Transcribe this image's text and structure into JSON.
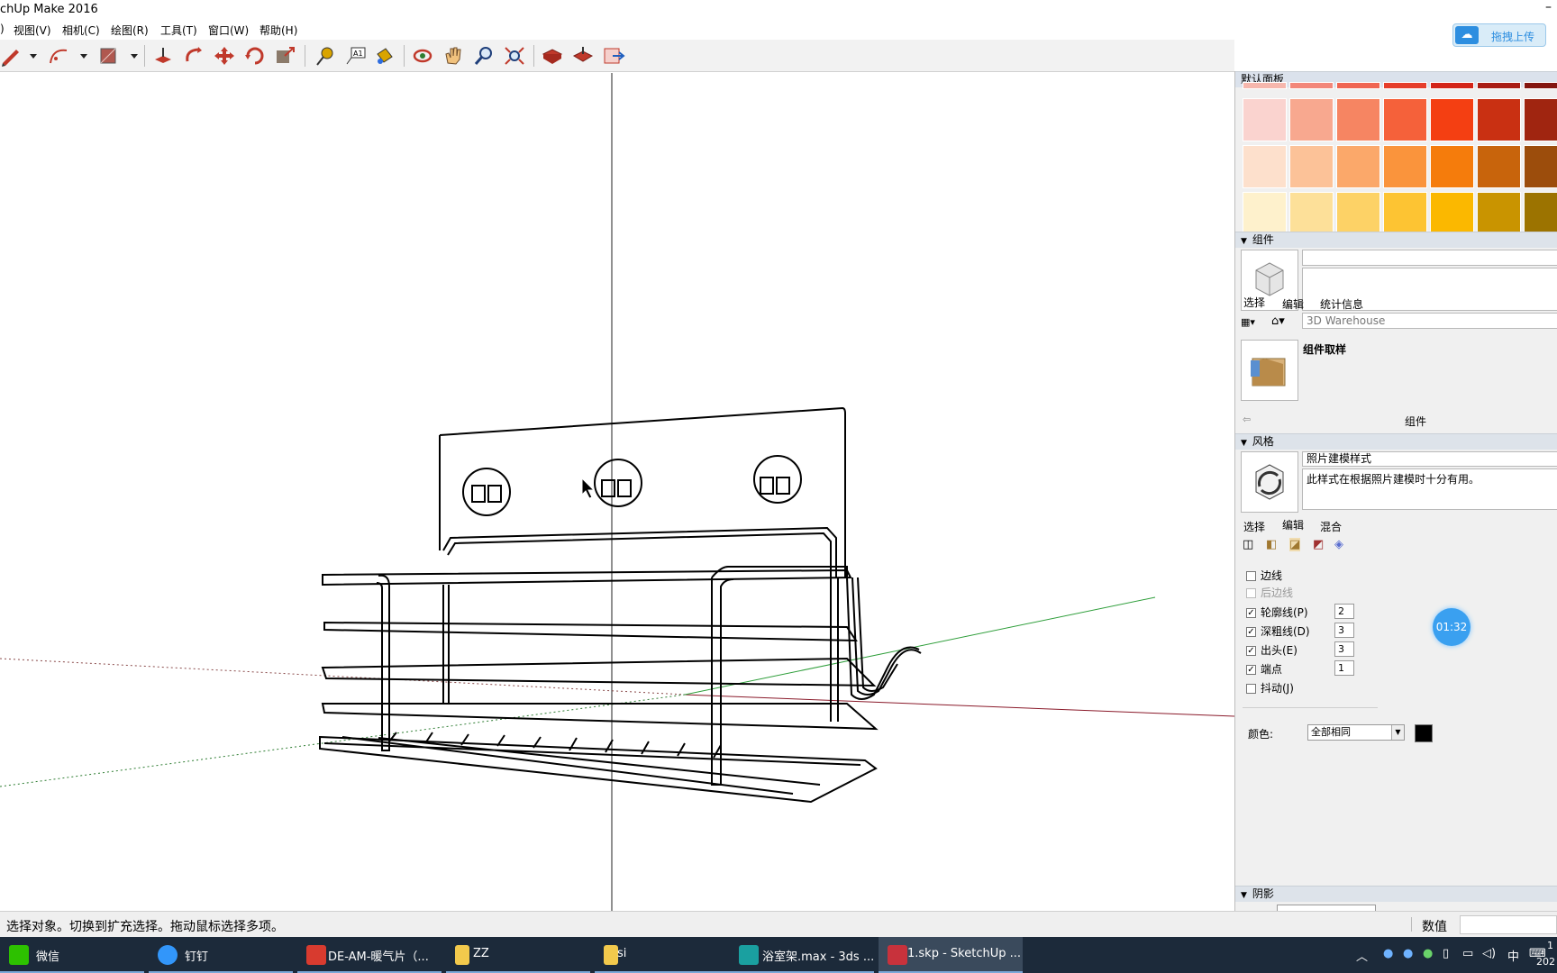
{
  "window": {
    "title": "chUp Make 2016",
    "minimize_glyph": "–"
  },
  "menu": [
    "视图(V)",
    "相机(C)",
    "绘图(R)",
    "工具(T)",
    "窗口(W)",
    "帮助(H)"
  ],
  "cloud_upload": {
    "label": "拖拽上传",
    "icon": "baidu-cloud-icon"
  },
  "toolbar": [
    "pencil-icon",
    "dropdown-arrow-icon",
    "arc-icon",
    "dropdown-arrow-icon",
    "rectangle-icon",
    "dropdown-arrow-icon",
    "push-pull-icon",
    "follow-me-icon",
    "move-icon",
    "rotate-icon",
    "scale-icon",
    "tape-measure-icon",
    "text-label-icon",
    "paint-bucket-icon",
    "orbit-icon",
    "pan-icon",
    "zoom-icon",
    "zoom-extents-icon",
    "warehouse-get-icon",
    "warehouse-share-icon",
    "extension-icon"
  ],
  "panels": {
    "materials": {
      "title": "默认面板",
      "swatches": [
        [
          "#fad3cf",
          "#f8a88f",
          "#f68562",
          "#f5613a",
          "#f43f12",
          "#c93012",
          "#a02510"
        ],
        [
          "#fde0cc",
          "#fcc298",
          "#fba86a",
          "#fa943c",
          "#f57c0c",
          "#c8640c",
          "#9c4d0c"
        ],
        [
          "#fef1cc",
          "#fde099",
          "#fdd266",
          "#fdc433",
          "#fbb800",
          "#c99400",
          "#9c7300"
        ]
      ]
    },
    "components": {
      "title": "组件",
      "tabs": [
        "选择",
        "编辑",
        "统计信息"
      ],
      "search_placeholder": "3D Warehouse",
      "item_title": "组件取样",
      "footer_label": "组件"
    },
    "styles": {
      "title": "风格",
      "style_name": "照片建模样式",
      "style_description": "此样式在根据照片建模时十分有用。",
      "tabs": [
        "选择",
        "编辑",
        "混合"
      ],
      "options": [
        {
          "label": "边线",
          "checked": false,
          "enabled": true,
          "value": ""
        },
        {
          "label": "后边线",
          "checked": false,
          "enabled": false,
          "value": ""
        },
        {
          "label": "轮廓线(P)",
          "checked": true,
          "enabled": true,
          "value": "2"
        },
        {
          "label": "深粗线(D)",
          "checked": true,
          "enabled": true,
          "value": "3"
        },
        {
          "label": "出头(E)",
          "checked": true,
          "enabled": true,
          "value": "3"
        },
        {
          "label": "端点",
          "checked": true,
          "enabled": true,
          "value": "1"
        },
        {
          "label": "抖动(J)",
          "checked": false,
          "enabled": true,
          "value": ""
        }
      ],
      "color_label": "颜色:",
      "color_mode": "全部相同",
      "edge_color": "#000000"
    },
    "shadows": {
      "title": "阴影"
    }
  },
  "timer": "01:32",
  "status": {
    "hint": "选择对象。切换到扩充选择。拖动鼠标选择多项。",
    "value_label": "数值"
  },
  "taskbar": [
    {
      "label": "微信",
      "icon_color": "#2dc100"
    },
    {
      "label": "钉钉",
      "icon_color": "#3296fa"
    },
    {
      "label": "DE-AM-暖气片（...",
      "icon_color": "#d83b2f"
    },
    {
      "label": "ZZ",
      "icon_color": "#f2c94c"
    },
    {
      "label": "si",
      "icon_color": "#f2c94c"
    },
    {
      "label": "浴室架.max - 3ds ...",
      "icon_color": "#1aa0a0"
    },
    {
      "label": "1.skp - SketchUp ...",
      "icon_color": "#c8323c"
    }
  ],
  "tray": {
    "ime": "中",
    "clock_top": "1",
    "clock_bottom": "202"
  }
}
